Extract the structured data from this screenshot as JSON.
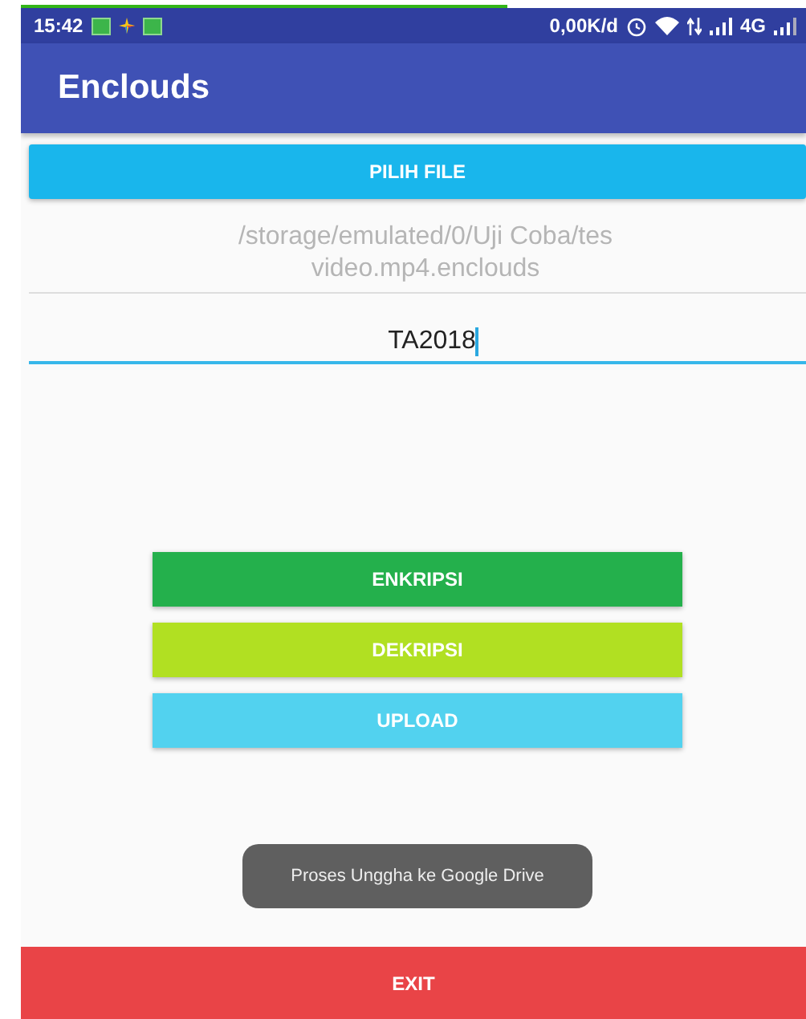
{
  "status_bar": {
    "time": "15:42",
    "speed": "0,00K/d",
    "network": "4G"
  },
  "load_progress": {
    "level": 0.62
  },
  "app_bar": {
    "title": "Enclouds"
  },
  "pick_button": {
    "label": "PILIH FILE"
  },
  "file_path": "/storage/emulated/0/Uji Coba/tes video.mp4.enclouds",
  "key_field": {
    "value": "TA2018",
    "focused": true
  },
  "actions": [
    {
      "label": "ENKRIPSI",
      "color": "#24b04c"
    },
    {
      "label": "DEKRIPSI",
      "color": "#b1e022"
    },
    {
      "label": "UPLOAD",
      "color": "#52d2ef"
    }
  ],
  "toast": "Proses Unggha ke Google Drive",
  "exit_button": {
    "label": "EXIT"
  }
}
